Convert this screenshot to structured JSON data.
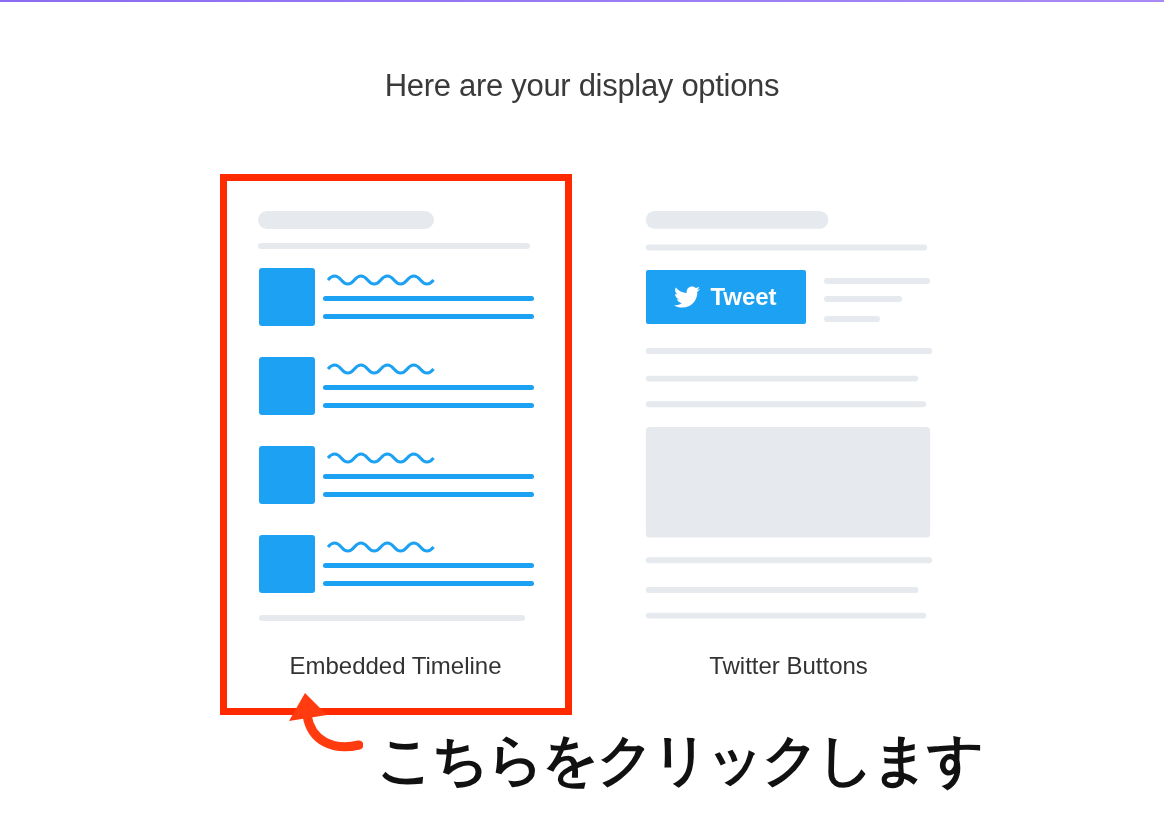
{
  "heading": "Here are your display options",
  "options": [
    {
      "kind": "timeline",
      "label": "Embedded Timeline",
      "selected": true
    },
    {
      "kind": "buttons",
      "label": "Twitter Buttons",
      "selected": false,
      "button_text": "Tweet"
    }
  ],
  "annotation": {
    "text": "こちらをクリックします"
  }
}
